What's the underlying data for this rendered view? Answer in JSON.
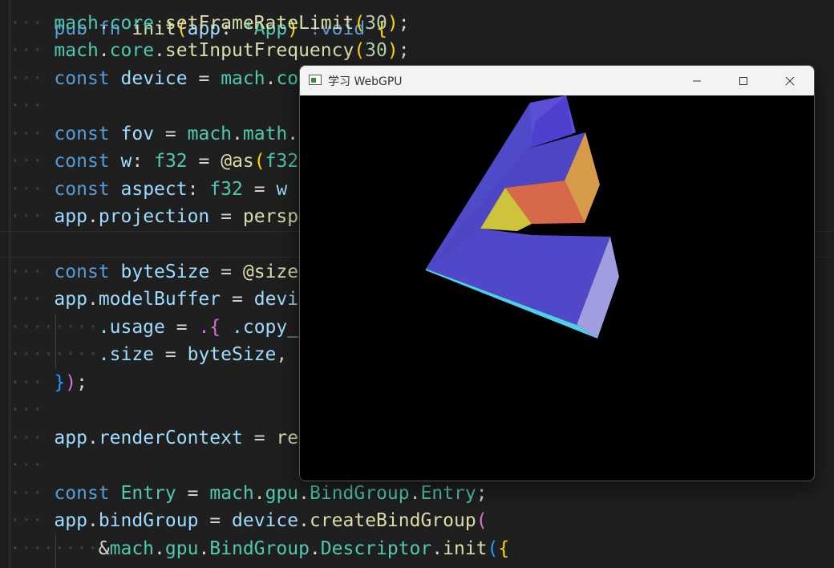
{
  "window": {
    "title": "学习 WebGPU",
    "minimize_icon": "minimize-icon",
    "maximize_icon": "maximize-icon",
    "close_icon": "close-icon"
  },
  "colors": {
    "editor_bg": "#1f1f1f",
    "keyword": "#569cd6",
    "identifier": "#9cdcfe",
    "namespace": "#4ec9b0",
    "function": "#dcdcaa",
    "number": "#b5cea8",
    "bracket_gold": "#ffd700",
    "bracket_pink": "#da70d6",
    "bracket_blue": "#179fff",
    "shape_blue": "#5048c8",
    "shape_orange": "#d7684a",
    "shape_yellow": "#cdc43c",
    "shape_lilac": "#a09ee0",
    "shape_cyan": "#4fd0e8"
  },
  "code": {
    "line0": {
      "kw1": "pub",
      "kw2": "fn",
      "fn": "init",
      "p": "(",
      "id": "app",
      "col": ":",
      "ty": "*App",
      "p2": ")",
      "kw3": "!void",
      "br": "{"
    },
    "line1": {
      "a": "mach",
      "b": "core",
      "c": "setFrameRateLimit",
      "n": "30",
      "e": ";"
    },
    "line2": {
      "a": "mach",
      "b": "core",
      "c": "setInputFrequency",
      "n": "30",
      "e": ";"
    },
    "line3": {
      "kw": "const",
      "id": "device",
      "eq": "=",
      "a": "mach",
      "b": "co"
    },
    "line5": {
      "kw": "const",
      "id": "fov",
      "eq": "=",
      "a": "mach",
      "b": "math",
      "rest": "."
    },
    "line6": {
      "kw": "const",
      "id": "w",
      "col": ":",
      "ty": "f32",
      "eq": "=",
      "bi": "@as",
      "p": "(",
      "ty2": "f32"
    },
    "line7": {
      "kw": "const",
      "id": "aspect",
      "col": ":",
      "ty": "f32",
      "eq": "=",
      "id2": "w"
    },
    "line8": {
      "a": "app",
      "b": "projection",
      "eq": "=",
      "c": "persp"
    },
    "line10": {
      "kw": "const",
      "id": "byteSize",
      "eq": "=",
      "bi": "@size"
    },
    "line11": {
      "a": "app",
      "b": "modelBuffer",
      "eq": "=",
      "c": "devi"
    },
    "line12": {
      "a": ".usage",
      "eq": "=",
      "b": ".{",
      "c": ".copy_"
    },
    "line13": {
      "a": ".size",
      "eq": "=",
      "b": "byteSize",
      "c": ","
    },
    "line14": {
      "a": "}",
      "b": ")",
      "c": ";"
    },
    "line16": {
      "a": "app",
      "b": "renderContext",
      "eq": "=",
      "c": "re"
    },
    "line18": {
      "kw": "const",
      "id": "Entry",
      "eq": "=",
      "a": "mach",
      "b": "gpu",
      "c": "BindGroup",
      "d": "Entry",
      "e": ";"
    },
    "line19": {
      "a": "app",
      "b": "bindGroup",
      "eq": "=",
      "c": "device",
      "d": "createBindGroup",
      "p": "("
    },
    "line20": {
      "amp": "&",
      "a": "mach",
      "b": "gpu",
      "c": "BindGroup",
      "d": "Descriptor",
      "e": "init",
      "p": "(",
      ".": ".",
      "br": "{"
    }
  }
}
